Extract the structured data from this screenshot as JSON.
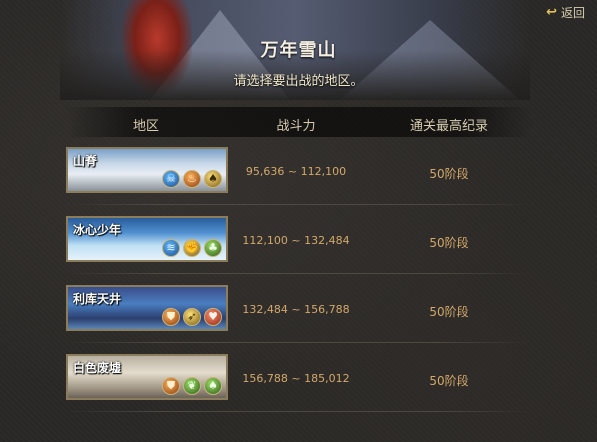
{
  "back": {
    "label": "返回",
    "icon": "back-arrow-icon"
  },
  "header": {
    "title": "万年雪山",
    "subtitle": "请选择要出战的地区。"
  },
  "table": {
    "columns": [
      "地区",
      "战斗力",
      "通关最高纪录"
    ],
    "rows": [
      {
        "name": "山脊",
        "range": "95,636 ~ 112,100",
        "record": "50阶段",
        "icons": [
          {
            "name": "blue-skull-icon",
            "glyph": "☠",
            "color": "blue"
          },
          {
            "name": "orange-flame-icon",
            "glyph": "♨",
            "color": "orange"
          },
          {
            "name": "gold-spade-icon",
            "glyph": "♠",
            "color": "gold"
          }
        ]
      },
      {
        "name": "冰心少年",
        "range": "112,100 ~ 132,484",
        "record": "50阶段",
        "icons": [
          {
            "name": "blue-wave-icon",
            "glyph": "≋",
            "color": "blue"
          },
          {
            "name": "gold-fist-icon",
            "glyph": "✊",
            "color": "gold"
          },
          {
            "name": "green-club-icon",
            "glyph": "♣",
            "color": "green"
          }
        ]
      },
      {
        "name": "利库天井",
        "range": "132,484 ~ 156,788",
        "record": "50阶段",
        "icons": [
          {
            "name": "orange-shield-icon",
            "glyph": "⛊",
            "color": "orange"
          },
          {
            "name": "gold-boot-icon",
            "glyph": "➶",
            "color": "gold"
          },
          {
            "name": "red-heart-icon",
            "glyph": "♥",
            "color": "red"
          }
        ]
      },
      {
        "name": "白色废墟",
        "range": "156,788 ~ 185,012",
        "record": "50阶段",
        "icons": [
          {
            "name": "orange-shield-icon",
            "glyph": "⛊",
            "color": "orange"
          },
          {
            "name": "green-leaf-icon",
            "glyph": "❦",
            "color": "green"
          },
          {
            "name": "green-spade-icon",
            "glyph": "♠",
            "color": "green"
          }
        ]
      }
    ]
  }
}
